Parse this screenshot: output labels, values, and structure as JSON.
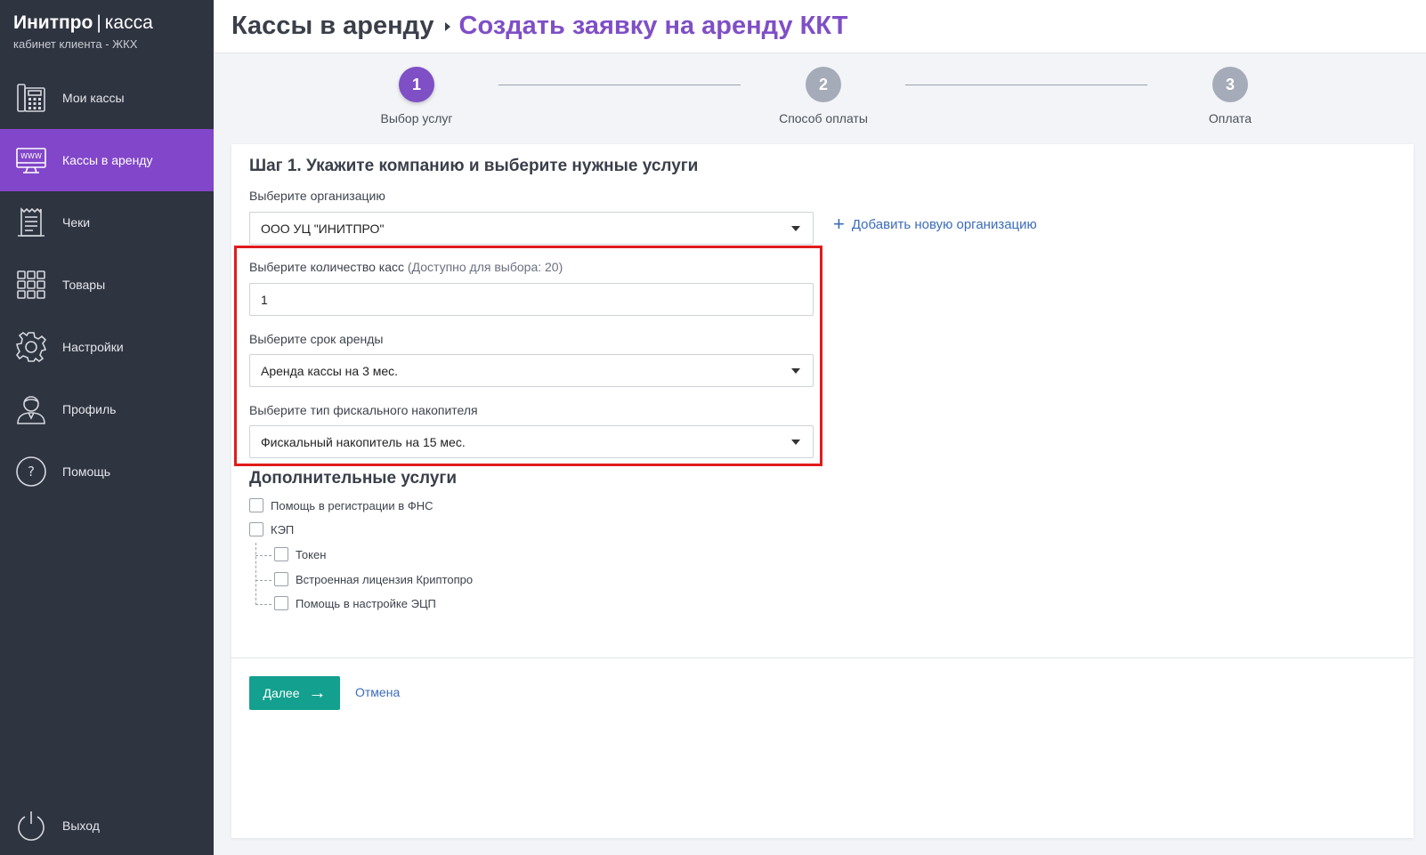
{
  "brand": {
    "name": "Инитпро",
    "product": "касса",
    "subtitle": "кабинет клиента - ЖКХ"
  },
  "nav": {
    "items": [
      {
        "label": "Мои кассы",
        "icon": "cash-register-icon"
      },
      {
        "label": "Кассы в аренду",
        "icon": "monitor-www-icon",
        "active": true
      },
      {
        "label": "Чеки",
        "icon": "receipt-icon"
      },
      {
        "label": "Товары",
        "icon": "grid-icon"
      },
      {
        "label": "Настройки",
        "icon": "gear-icon"
      },
      {
        "label": "Профиль",
        "icon": "user-icon"
      },
      {
        "label": "Помощь",
        "icon": "help-icon"
      }
    ],
    "logout": "Выход"
  },
  "header": {
    "root": "Кассы в аренду",
    "current": "Создать заявку на аренду ККТ"
  },
  "steps": [
    {
      "num": "1",
      "label": "Выбор услуг",
      "active": true
    },
    {
      "num": "2",
      "label": "Способ оплаты"
    },
    {
      "num": "3",
      "label": "Оплата"
    }
  ],
  "form": {
    "title": "Шаг 1. Укажите компанию и выберите нужные услуги",
    "org_label": "Выберите организацию",
    "org_value": "ООО УЦ \"ИНИТПРО\"",
    "add_org": "Добавить новую организацию",
    "count_label": "Выберите количество касс",
    "count_hint": "(Доступно для выбора: 20)",
    "count_value": "1",
    "term_label": "Выберите срок аренды",
    "term_value": "Аренда кассы на 3 мес.",
    "fn_label": "Выберите тип фискального накопителя",
    "fn_value": "Фискальный накопитель на 15 мес.",
    "extra_title": "Дополнительные услуги",
    "extras": {
      "fns": "Помощь в регистрации в ФНС",
      "kep": "КЭП",
      "token": "Токен",
      "cryptopro": "Встроенная лицензия Криптопро",
      "ecp_help": "Помощь в настройке ЭЦП"
    },
    "next": "Далее",
    "cancel": "Отмена"
  },
  "colors": {
    "accent": "#7f4fc6",
    "sidebar": "#2f3441",
    "primary_button": "#14a08f",
    "link": "#3b6cb8",
    "highlight": "#e01b1b"
  }
}
